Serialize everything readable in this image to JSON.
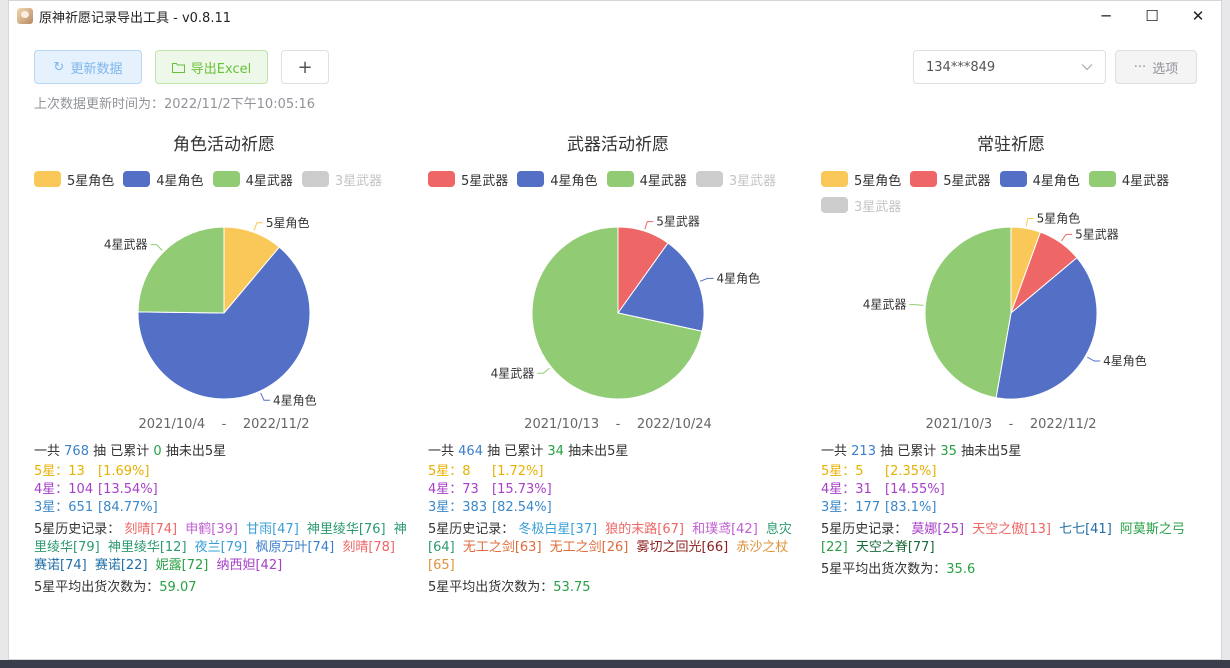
{
  "window": {
    "title": "原神祈愿记录导出工具 - v0.8.11",
    "minimize": "─",
    "maximize": "☐",
    "close": "✕"
  },
  "toolbar": {
    "refresh_label": "更新数据",
    "export_label": "导出Excel",
    "add_label": "+",
    "account_value": "134***849",
    "options_label": "选项",
    "update_time": "上次数据更新时间为：2022/11/2下午10:05:16"
  },
  "colors": {
    "5星角色": "#f9c858",
    "5星武器": "#ee6666",
    "4星角色": "#5470c6",
    "4星武器": "#91cc75",
    "3星武器": "#cccccc"
  },
  "panels": [
    {
      "title": "角色活动祈愿",
      "legend": [
        {
          "name": "5星角色",
          "color": "#f9c858",
          "off": false
        },
        {
          "name": "4星角色",
          "color": "#5470c6",
          "off": false
        },
        {
          "name": "4星武器",
          "color": "#91cc75",
          "off": false
        },
        {
          "name": "3星武器",
          "color": "#cccccc",
          "off": true
        }
      ],
      "chart_data": {
        "type": "pie",
        "slices": [
          {
            "name": "5星角色",
            "value": 13,
            "color": "#f9c858"
          },
          {
            "name": "4星角色",
            "value": 75,
            "color": "#5470c6"
          },
          {
            "name": "4星武器",
            "value": 29,
            "color": "#91cc75"
          }
        ]
      },
      "date_start": "2021/10/4",
      "date_sep": "-",
      "date_end": "2022/11/2",
      "total_prefix": "一共",
      "total": "768",
      "total_mid": "抽 已累计",
      "pity": "0",
      "total_suffix": "抽未出5星",
      "star5": "5星：13",
      "star5_pct": "[1.69%]",
      "star4": "4星：104",
      "star4_pct": "[13.54%]",
      "star3": "3星：651",
      "star3_pct": "[84.77%]",
      "history_label": "5星历史记录：",
      "history": [
        {
          "text": "刻晴[74]",
          "color": "#ee6666"
        },
        {
          "text": "申鹤[39]",
          "color": "#c05fd1"
        },
        {
          "text": "甘雨[47]",
          "color": "#3a9fd6"
        },
        {
          "text": "神里绫华[76]",
          "color": "#2c9a6f"
        },
        {
          "text": "神里绫华[79]",
          "color": "#2c9a6f"
        },
        {
          "text": "神里绫华[12]",
          "color": "#2c9a6f"
        },
        {
          "text": "夜兰[79]",
          "color": "#3a9fd6"
        },
        {
          "text": "枫原万叶[74]",
          "color": "#3b80c9"
        },
        {
          "text": "刻晴[78]",
          "color": "#ee6666"
        },
        {
          "text": "赛诺[74]",
          "color": "#1f6fa8"
        },
        {
          "text": "赛诺[22]",
          "color": "#1f6fa8"
        },
        {
          "text": "妮露[72]",
          "color": "#27a045"
        },
        {
          "text": "纳西妲[42]",
          "color": "#a740c8"
        }
      ],
      "avg_label": "5星平均出货次数为：",
      "avg": "59.07"
    },
    {
      "title": "武器活动祈愿",
      "legend": [
        {
          "name": "5星武器",
          "color": "#ee6666",
          "off": false
        },
        {
          "name": "4星角色",
          "color": "#5470c6",
          "off": false
        },
        {
          "name": "4星武器",
          "color": "#91cc75",
          "off": false
        },
        {
          "name": "3星武器",
          "color": "#cccccc",
          "off": true
        }
      ],
      "chart_data": {
        "type": "pie",
        "slices": [
          {
            "name": "5星武器",
            "value": 8,
            "color": "#ee6666"
          },
          {
            "name": "4星角色",
            "value": 15,
            "color": "#5470c6"
          },
          {
            "name": "4星武器",
            "value": 58,
            "color": "#91cc75"
          }
        ]
      },
      "date_start": "2021/10/13",
      "date_sep": "-",
      "date_end": "2022/10/24",
      "total_prefix": "一共",
      "total": "464",
      "total_mid": "抽 已累计",
      "pity": "34",
      "total_suffix": "抽未出5星",
      "star5": "5星：8",
      "star5_pct": "[1.72%]",
      "star4": "4星：73",
      "star4_pct": "[15.73%]",
      "star3": "3星：383",
      "star3_pct": "[82.54%]",
      "history_label": "5星历史记录：",
      "history": [
        {
          "text": "冬极白星[37]",
          "color": "#3a9fd6"
        },
        {
          "text": "狼的末路[67]",
          "color": "#ee6666"
        },
        {
          "text": "和璞鸢[42]",
          "color": "#c05fd1"
        },
        {
          "text": "息灾[64]",
          "color": "#2c9a6f"
        },
        {
          "text": "无工之剑[63]",
          "color": "#e06c3b"
        },
        {
          "text": "无工之剑[26]",
          "color": "#e06c3b"
        },
        {
          "text": "雾切之回光[66]",
          "color": "#8a1c1c"
        },
        {
          "text": "赤沙之杖[65]",
          "color": "#e0923b"
        }
      ],
      "avg_label": "5星平均出货次数为：",
      "avg": "53.75"
    },
    {
      "title": "常驻祈愿",
      "legend": [
        {
          "name": "5星角色",
          "color": "#f9c858",
          "off": false
        },
        {
          "name": "5星武器",
          "color": "#ee6666",
          "off": false
        },
        {
          "name": "4星角色",
          "color": "#5470c6",
          "off": false
        },
        {
          "name": "4星武器",
          "color": "#91cc75",
          "off": false
        },
        {
          "name": "3星武器",
          "color": "#cccccc",
          "off": true
        }
      ],
      "chart_data": {
        "type": "pie",
        "slices": [
          {
            "name": "5星角色",
            "value": 2,
            "color": "#f9c858"
          },
          {
            "name": "5星武器",
            "value": 3,
            "color": "#ee6666"
          },
          {
            "name": "4星角色",
            "value": 14,
            "color": "#5470c6"
          },
          {
            "name": "4星武器",
            "value": 17,
            "color": "#91cc75"
          }
        ]
      },
      "date_start": "2021/10/3",
      "date_sep": "-",
      "date_end": "2022/11/2",
      "total_prefix": "一共",
      "total": "213",
      "total_mid": "抽 已累计",
      "pity": "35",
      "total_suffix": "抽未出5星",
      "star5": "5星：5",
      "star5_pct": "[2.35%]",
      "star4": "4星：31",
      "star4_pct": "[14.55%]",
      "star3": "3星：177",
      "star3_pct": "[83.1%]",
      "history_label": "5星历史记录：",
      "history": [
        {
          "text": "莫娜[25]",
          "color": "#a740c8"
        },
        {
          "text": "天空之傲[13]",
          "color": "#ee6666"
        },
        {
          "text": "七七[41]",
          "color": "#1f6fa8"
        },
        {
          "text": "阿莫斯之弓[22]",
          "color": "#27a045"
        },
        {
          "text": "天空之脊[77]",
          "color": "#1a6b3a"
        }
      ],
      "avg_label": "5星平均出货次数为：",
      "avg": "35.6"
    }
  ]
}
